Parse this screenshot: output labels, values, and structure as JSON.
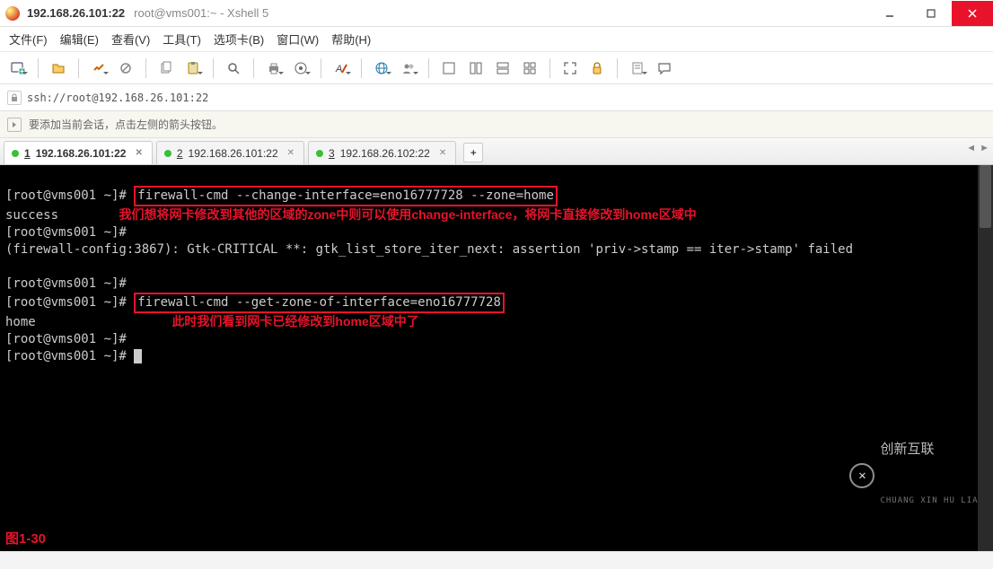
{
  "window": {
    "title_strong": "192.168.26.101:22",
    "title_light": "root@vms001:~ - Xshell 5"
  },
  "menu": {
    "file": "文件(F)",
    "edit": "编辑(E)",
    "view": "查看(V)",
    "tools": "工具(T)",
    "tab": "选项卡(B)",
    "window": "窗口(W)",
    "help": "帮助(H)"
  },
  "addressbar": {
    "url": "ssh://root@192.168.26.101:22"
  },
  "infobar": {
    "text": "要添加当前会话，点击左侧的箭头按钮。"
  },
  "tabs": [
    {
      "num": "1",
      "label": "192.168.26.101:22",
      "active": true
    },
    {
      "num": "2",
      "label": "192.168.26.101:22",
      "active": false
    },
    {
      "num": "3",
      "label": "192.168.26.102:22",
      "active": false
    }
  ],
  "term": {
    "p1": "[root@vms001 ~]# ",
    "cmd1": "firewall-cmd --change-interface=eno16777728 --zone=home",
    "l2": "success",
    "ann1": "我们想将网卡修改到其他的区域的zone中则可以使用change-interface，将网卡直接修改到home区域中",
    "p3": "[root@vms001 ~]# ",
    "l4": "(firewall-config:3867): Gtk-CRITICAL **: gtk_list_store_iter_next: assertion 'priv->stamp == iter->stamp' failed",
    "blank": "",
    "p5": "[root@vms001 ~]# ",
    "p6": "[root@vms001 ~]# ",
    "cmd2": "firewall-cmd --get-zone-of-interface=eno16777728",
    "l7": "home",
    "ann2": "此时我们看到网卡已经修改到home区域中了",
    "p8": "[root@vms001 ~]# ",
    "p9": "[root@vms001 ~]# ",
    "figlabel": "图1-30"
  },
  "watermark": {
    "brand": "创新互联",
    "sub": "CHUANG XIN HU LIAN"
  },
  "status": {
    "text": ""
  }
}
